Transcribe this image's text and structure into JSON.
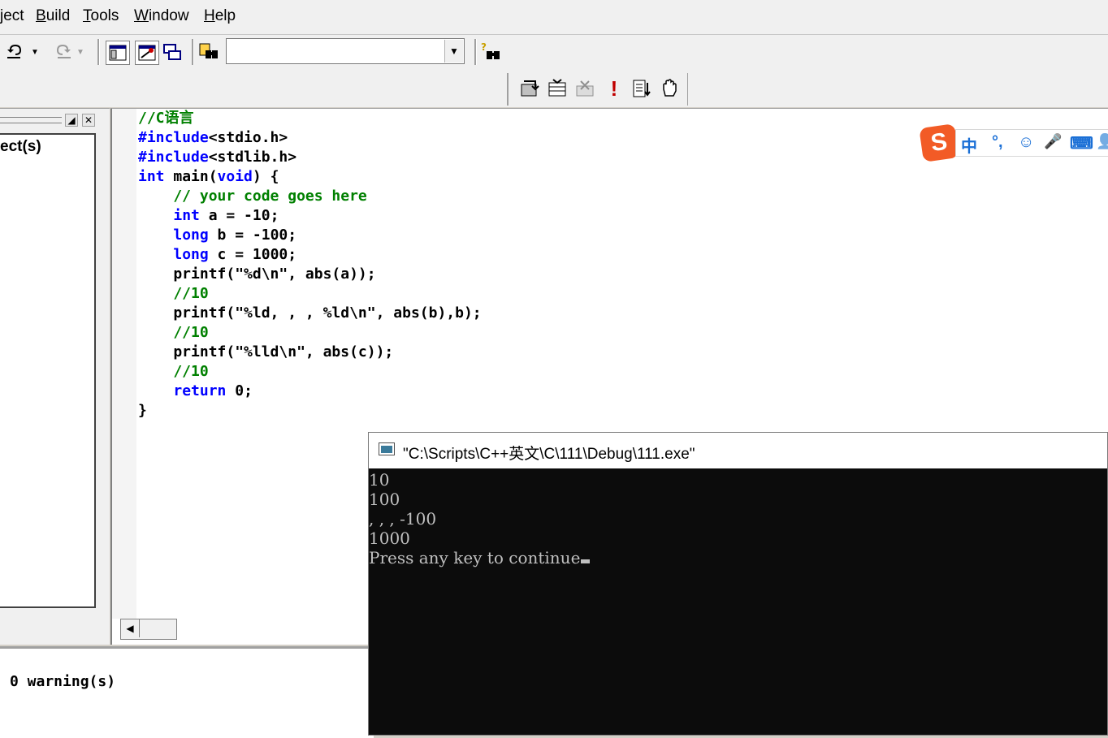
{
  "menubar": {
    "items": [
      {
        "label": "ject",
        "ul": ""
      },
      {
        "label": "Build",
        "ul": "B"
      },
      {
        "label": "Tools",
        "ul": "T"
      },
      {
        "label": "Window",
        "ul": "W"
      },
      {
        "label": "Help",
        "ul": "H"
      }
    ]
  },
  "toolbar": {
    "combo_value": "",
    "icons": [
      "undo-icon",
      "redo-icon",
      "workspace-icon",
      "output-window-icon",
      "windows-list-icon",
      "find-in-files-icon",
      "wizard-bar-icon",
      "compile-icon",
      "build-icon",
      "stop-build-icon",
      "execute-icon",
      "go-icon",
      "breakpoint-icon"
    ]
  },
  "workspace": {
    "tree_label": "ect(s)"
  },
  "editor": {
    "lines": [
      [
        {
          "t": "//C语言",
          "c": "cm"
        }
      ],
      [
        {
          "t": "#include",
          "c": "kw"
        },
        {
          "t": "<stdio.h>",
          "c": ""
        }
      ],
      [
        {
          "t": "#include",
          "c": "kw"
        },
        {
          "t": "<stdlib.h>",
          "c": ""
        }
      ],
      [
        {
          "t": "int",
          "c": "kw"
        },
        {
          "t": " main(",
          "c": ""
        },
        {
          "t": "void",
          "c": "kw"
        },
        {
          "t": ") {",
          "c": ""
        }
      ],
      [
        {
          "t": "    // your code goes here",
          "c": "cm"
        }
      ],
      [
        {
          "t": "    ",
          "c": ""
        },
        {
          "t": "int",
          "c": "kw"
        },
        {
          "t": " a = -10;",
          "c": ""
        }
      ],
      [
        {
          "t": "    ",
          "c": ""
        },
        {
          "t": "long",
          "c": "kw"
        },
        {
          "t": " b = -100;",
          "c": ""
        }
      ],
      [
        {
          "t": "    ",
          "c": ""
        },
        {
          "t": "long",
          "c": "kw"
        },
        {
          "t": " c = 1000;",
          "c": ""
        }
      ],
      [
        {
          "t": "    printf(\"%d\\n\", abs(a));",
          "c": ""
        }
      ],
      [
        {
          "t": "    //10",
          "c": "cm"
        }
      ],
      [
        {
          "t": "    printf(\"%ld, , , %ld\\n\", abs(b),b);",
          "c": ""
        }
      ],
      [
        {
          "t": "    //10",
          "c": "cm"
        }
      ],
      [
        {
          "t": "    printf(\"%lld\\n\", abs(c));",
          "c": ""
        }
      ],
      [
        {
          "t": "    //10",
          "c": "cm"
        }
      ],
      [
        {
          "t": "    ",
          "c": ""
        },
        {
          "t": "return",
          "c": "kw"
        },
        {
          "t": " 0;",
          "c": ""
        }
      ],
      [
        {
          "t": "}",
          "c": ""
        }
      ]
    ]
  },
  "output": {
    "text": "0 warning(s)"
  },
  "ime": {
    "logo": "S",
    "items": [
      "中",
      "°,",
      "☺",
      "🎤",
      "⌨",
      "👤"
    ]
  },
  "console": {
    "title": "\"C:\\Scripts\\C++英文\\C\\111\\Debug\\111.exe\"",
    "lines": [
      "10",
      "100",
      ", , , -100",
      "1000",
      "Press any key to continue"
    ]
  }
}
